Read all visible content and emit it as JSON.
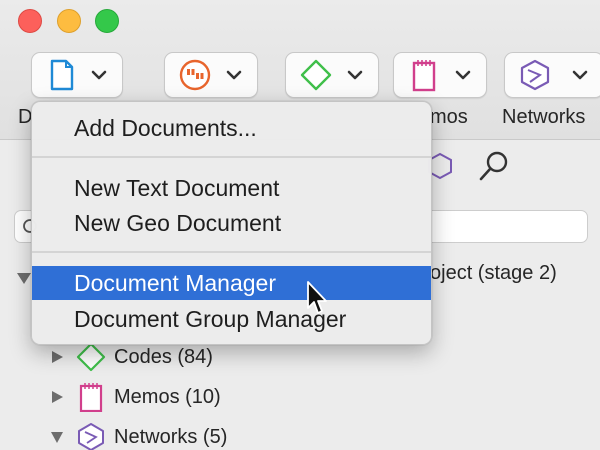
{
  "toolbar": {
    "buttons": [
      {
        "id": "documents",
        "icon": "document-icon",
        "label": "D"
      },
      {
        "id": "quotations",
        "icon": "quotation-icon",
        "label": ""
      },
      {
        "id": "codes",
        "icon": "code-diamond-icon",
        "label": ""
      },
      {
        "id": "memos",
        "icon": "memo-icon",
        "label": "mos"
      },
      {
        "id": "networks",
        "icon": "network-icon",
        "label": "Networks"
      }
    ]
  },
  "menu": {
    "items": [
      {
        "label": "Add Documents...",
        "selected": false
      },
      {
        "label": "New Text Document",
        "selected": false
      },
      {
        "label": "New Geo Document",
        "selected": false
      },
      {
        "label": "Document Manager",
        "selected": true
      },
      {
        "label": "Document Group Manager",
        "selected": false
      }
    ]
  },
  "sidebar": {
    "search_placeholder": "",
    "project_tail": "oject (stage 2)",
    "tree": [
      {
        "label": "Codes (84)",
        "icon": "code-diamond-icon",
        "expanded": false
      },
      {
        "label": "Memos (10)",
        "icon": "memo-icon",
        "expanded": false
      },
      {
        "label": "Networks (5)",
        "icon": "network-icon",
        "expanded": true
      }
    ]
  },
  "colors": {
    "document_blue": "#1f8ad6",
    "quotation_orange": "#e8652d",
    "code_green": "#3fbf4a",
    "memo_magenta": "#d13f8c",
    "network_purple": "#7a5bb5",
    "selection_blue": "#2f6fd6"
  }
}
